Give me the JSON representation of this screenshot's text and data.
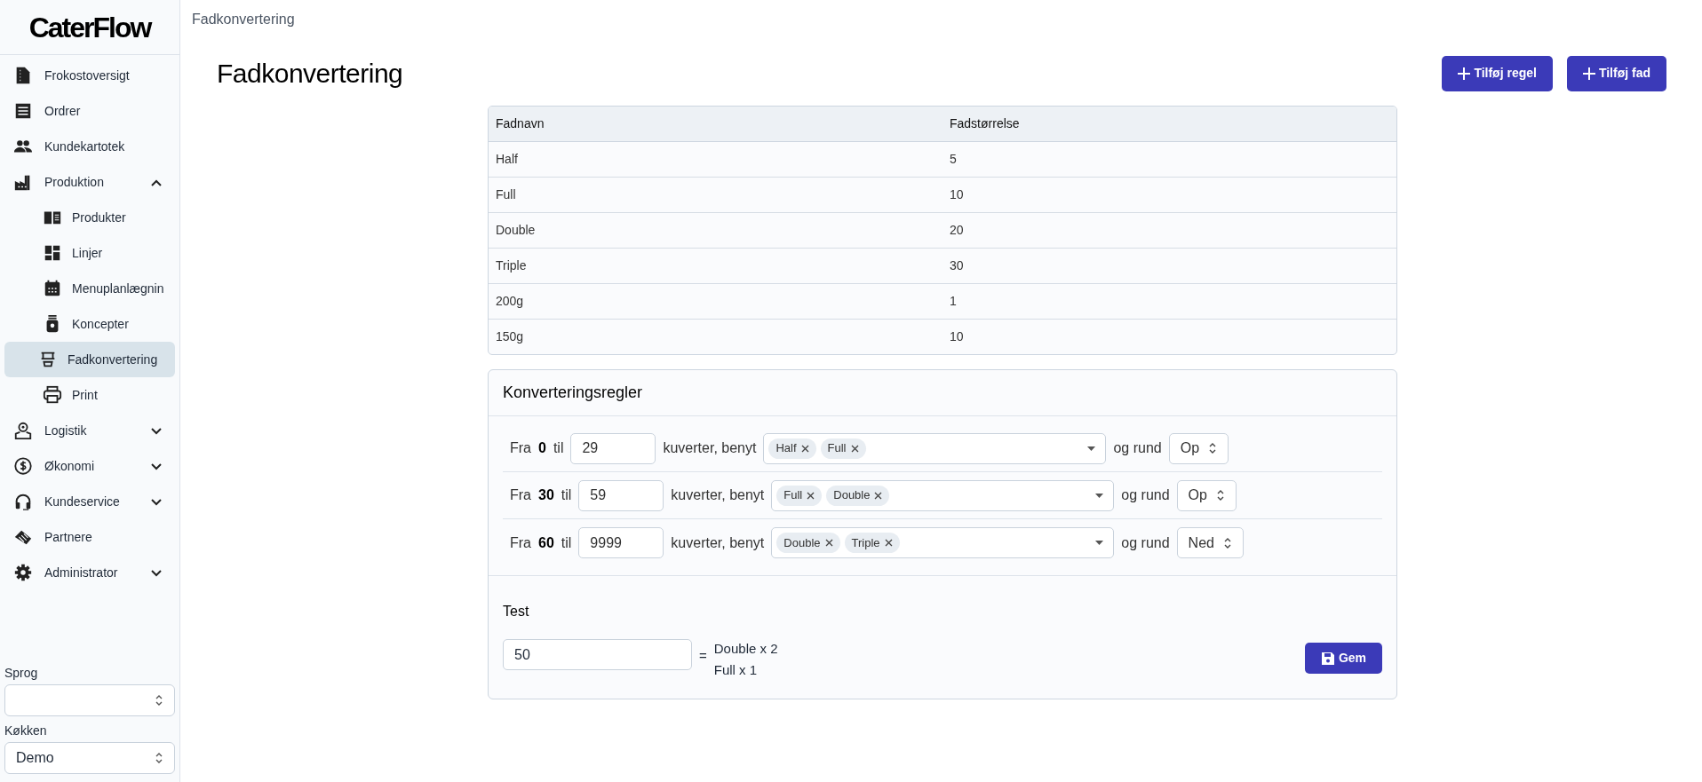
{
  "logo": "CaterFlow",
  "sidebar": {
    "items": [
      {
        "label": "Frokostoversigt",
        "selected": false
      },
      {
        "label": "Ordrer",
        "selected": false
      },
      {
        "label": "Kundekartotek",
        "selected": false
      },
      {
        "label": "Produktion",
        "selected": false,
        "expanded": true,
        "children": [
          {
            "label": "Produkter",
            "selected": false
          },
          {
            "label": "Linjer",
            "selected": false
          },
          {
            "label": "Menuplanlægnin",
            "selected": false
          },
          {
            "label": "Koncepter",
            "selected": false
          },
          {
            "label": "Fadkonvertering",
            "selected": true
          },
          {
            "label": "Print",
            "selected": false
          }
        ]
      },
      {
        "label": "Logistik",
        "selected": false,
        "expanded": false
      },
      {
        "label": "Økonomi",
        "selected": false,
        "expanded": false
      },
      {
        "label": "Kundeservice",
        "selected": false,
        "expanded": false
      },
      {
        "label": "Partnere",
        "selected": false
      },
      {
        "label": "Administrator",
        "selected": false,
        "expanded": false
      }
    ],
    "language": {
      "label": "Sprog"
    },
    "kitchen": {
      "label": "Køkken",
      "value": "Demo"
    }
  },
  "breadcrumb": "Fadkonvertering",
  "title": "Fadkonvertering",
  "buttons": [
    "Tilføj regel",
    "Tilføj fad"
  ],
  "table": {
    "columns": [
      "Fadnavn",
      "Fadstørrelse"
    ],
    "rows": [
      [
        "Half",
        "5"
      ],
      [
        "Full",
        "10"
      ],
      [
        "Double",
        "20"
      ],
      [
        "Triple",
        "30"
      ],
      [
        "200g",
        "1"
      ],
      [
        "150g",
        "10"
      ]
    ]
  },
  "rules": {
    "title": "Konverteringsregler",
    "items": [
      {
        "from_label": "Fra",
        "from": "0",
        "to_label": "til",
        "to": "29",
        "use_label": "kuverter, benyt",
        "dishes": [
          "Half",
          "Full"
        ],
        "round_label": "og rund",
        "round": "Op"
      },
      {
        "from_label": "Fra",
        "from": "30",
        "to_label": "til",
        "to": "59",
        "use_label": "kuverter, benyt",
        "dishes": [
          "Full",
          "Double"
        ],
        "round_label": "og rund",
        "round": "Op"
      },
      {
        "from_label": "Fra",
        "from": "60",
        "to_label": "til",
        "to": "9999",
        "use_label": "kuverter, benyt",
        "dishes": [
          "Double",
          "Triple"
        ],
        "round_label": "og rund",
        "round": "Ned"
      }
    ],
    "test": {
      "label": "Test",
      "value": "50",
      "equals": "=",
      "results": [
        "Double x 2",
        "Full x 1"
      ]
    },
    "save": "Gem"
  }
}
